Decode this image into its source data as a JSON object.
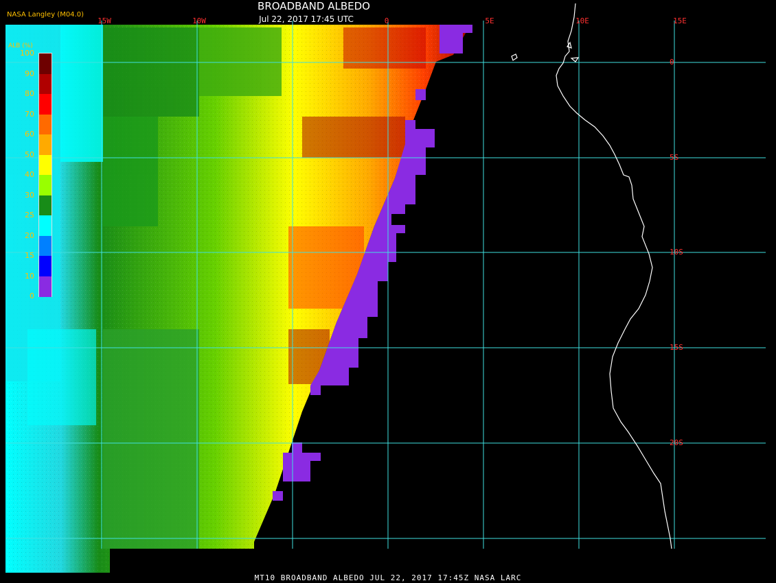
{
  "header": {
    "title": "BROADBAND ALBEDO",
    "subtitle": "Jul 22, 2017 17:45 UTC",
    "producer": "NASA Langley (M04.0)"
  },
  "legend": {
    "title": "ALB (%)",
    "ticks": [
      "100",
      "90",
      "80",
      "70",
      "60",
      "50",
      "40",
      "30",
      "25",
      "20",
      "15",
      "10",
      "0"
    ],
    "colors": [
      "#6e0000",
      "#b00000",
      "#ff0000",
      "#ff6a00",
      "#ffaa00",
      "#ffff00",
      "#99ff00",
      "#188c18",
      "#00ffff",
      "#0080ff",
      "#0000ff",
      "#8a2be2"
    ]
  },
  "map": {
    "lon_labels": [
      "15W",
      "10W",
      "0",
      "5E",
      "10E",
      "15E"
    ],
    "lat_labels": [
      "0",
      "5S",
      "10S",
      "15S",
      "20S"
    ],
    "grid_color": "#40e0e0",
    "coast_color": "#ffffff",
    "no_data_color": "#8a2be2"
  },
  "footer": {
    "text": "MT10  BROADBAND ALBEDO   JUL 22, 2017 17:45Z   NASA LARC"
  }
}
